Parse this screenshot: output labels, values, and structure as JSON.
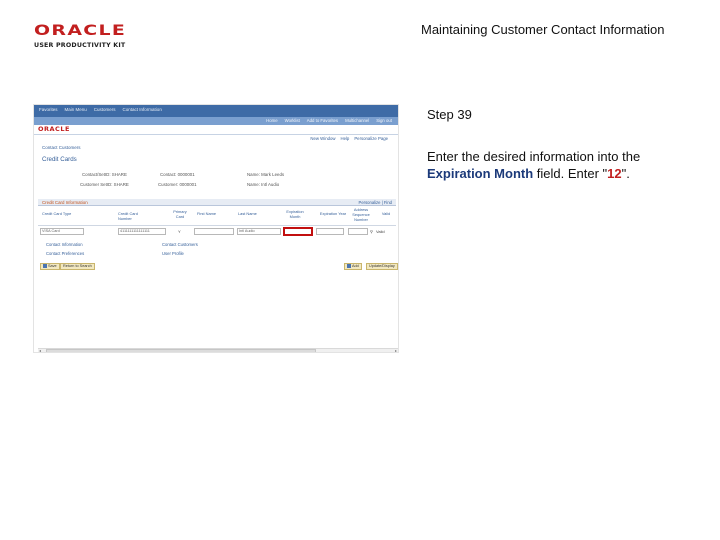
{
  "header": {
    "logo_text": "ORACLE",
    "logo_sub": "USER PRODUCTIVITY KIT",
    "doc_title": "Maintaining Customer Contact Information"
  },
  "step": {
    "label": "Step 39",
    "instr_part1": "Enter the desired information into the ",
    "instr_field": "Expiration Month",
    "instr_part2": " field. Enter \"",
    "instr_value": "12",
    "instr_part3": "\"."
  },
  "screenshot": {
    "nav_crumbs": [
      "Favorites",
      "Main Menu",
      "Customers",
      "Contact Information"
    ],
    "nav_links": [
      "Home",
      "Worklist",
      "Add to Favorites",
      "Multichannel",
      "Sign out"
    ],
    "brand": "ORACLE",
    "toplinks": [
      "New Window",
      "Help",
      "Personalize Page"
    ],
    "breadcrumb": "Contact Customers",
    "page_title": "Credit Cards",
    "info": {
      "row1_a": "Contact/SetID: SHARE",
      "row1_b": "Contact: 0000001",
      "row1_c": "Name: Mark Leeds",
      "row2_a": "Customer SetID: SHARE",
      "row2_b": "Customer: 0000001",
      "row2_c": "Name: Intl Audio"
    },
    "credit_card": {
      "title": "Credit Card Information",
      "nav": "Personalize | Find",
      "columns": [
        "Credit Card Type",
        "Credit Card Number",
        "Primary Card",
        "First Name",
        "Last Name",
        "Expiration Month",
        "Expiration Year",
        "Address Sequence Number",
        "Valid"
      ],
      "row": {
        "type": "VISA Card",
        "number": "4111111111111111",
        "primary": "Y",
        "last_name": "Intl Audio",
        "valid": "Valid"
      }
    },
    "links": {
      "contact_info": "Contact Information",
      "contact_customers": "Contact Customers",
      "contact_preferences": "Contact Preferences",
      "user_profile": "User Profile"
    },
    "buttons": {
      "save": "Save",
      "return": "Return to Search",
      "add": "Add",
      "update": "Update/Display"
    },
    "scroll": {
      "left": "◂",
      "right": "▸"
    }
  }
}
